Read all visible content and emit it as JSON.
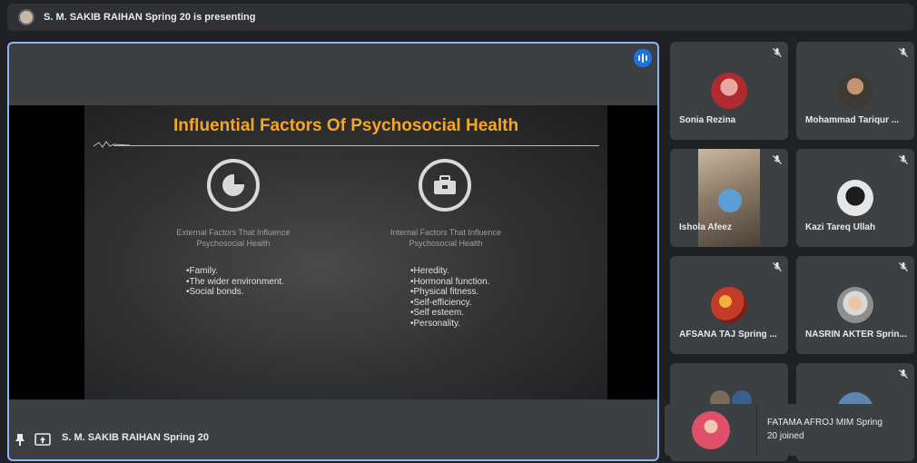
{
  "top_bar": {
    "presenter_text": "S. M. SAKIB RAIHAN Spring 20 is presenting"
  },
  "slide": {
    "title": "Influential Factors Of Psychosocial Health",
    "left": {
      "heading_line1": "External Factors That Influence",
      "heading_line2": "Psychosocial Health",
      "bullets": [
        "•Family.",
        "•The wider environment.",
        "•Social bonds."
      ]
    },
    "right": {
      "heading_line1": "Internal Factors That Influence",
      "heading_line2": "Psychosocial Health",
      "bullets": [
        "•Heredity.",
        "•Hormonal function.",
        "•Physical fitness.",
        "•Self-efficiency.",
        "•Self esteem.",
        "•Personality."
      ]
    }
  },
  "presenter_name": "S. M. SAKIB RAIHAN Spring 20",
  "participants": [
    {
      "name": "Sonia Rezina"
    },
    {
      "name": "Mohammad Tariqur ..."
    },
    {
      "name": "Ishola Afeez"
    },
    {
      "name": "Kazi Tareq Ullah"
    },
    {
      "name": "AFSANA TAJ Spring ..."
    },
    {
      "name": "NASRIN AKTER Sprin..."
    }
  ],
  "toast": {
    "line1": "FATAMA AFROJ MIM Spring",
    "line2": "20 joined"
  },
  "colors": {
    "accent": "#8ab4f8",
    "title_orange": "#f5a623",
    "tile_bg": "#3c4043",
    "page_bg": "#202124"
  }
}
